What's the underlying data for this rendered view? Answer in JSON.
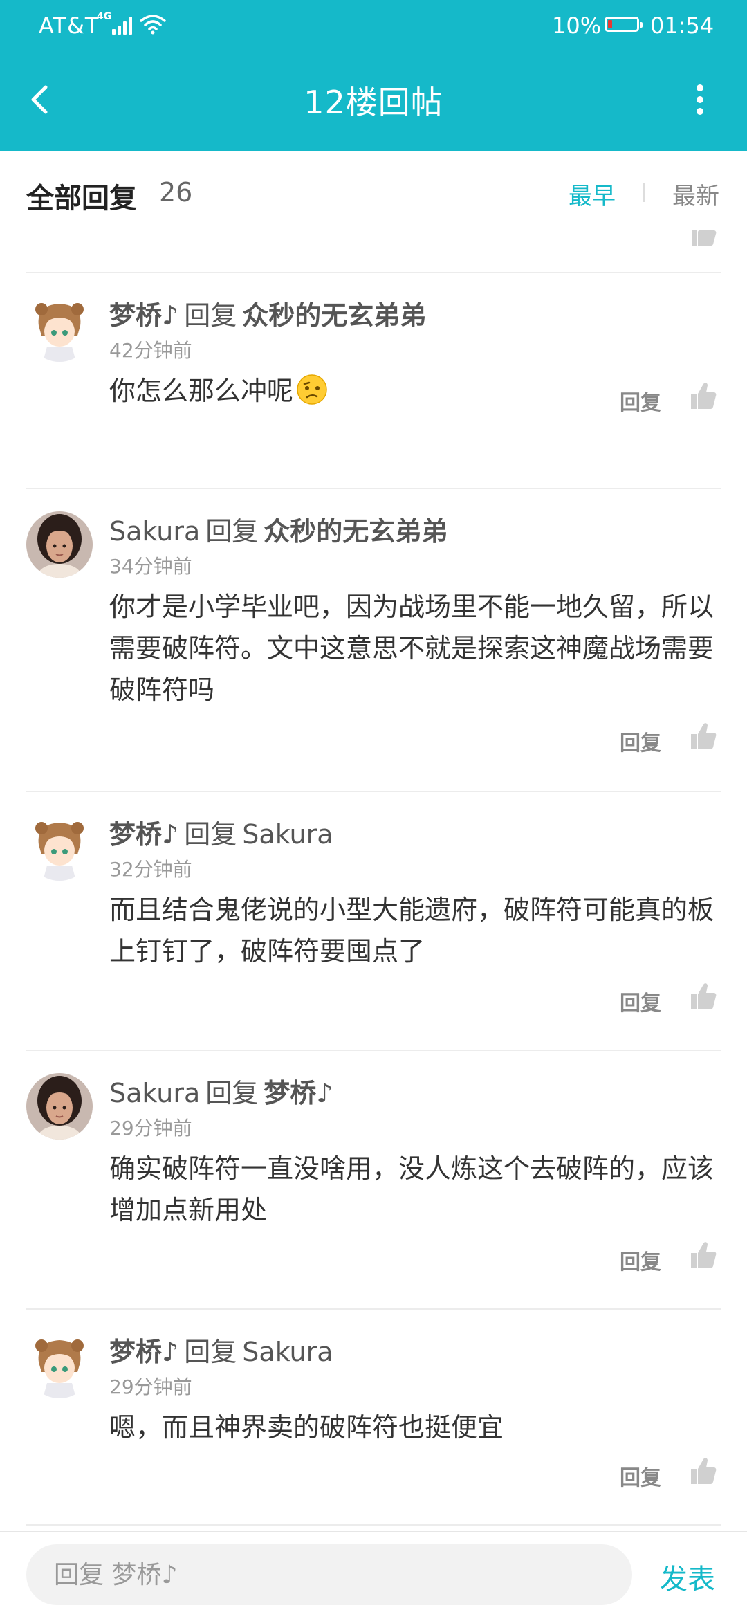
{
  "status_bar": {
    "carrier": "AT&T",
    "network": "4G",
    "battery_pct": "10%",
    "time": "01:54"
  },
  "nav": {
    "title": "12楼回帖"
  },
  "section": {
    "title": "全部回复",
    "count": "26",
    "sort_early": "最早",
    "sort_new": "最新"
  },
  "comments": [
    {
      "author": "梦桥♪",
      "reply_word": "回复",
      "target": "众秒的无玄弟弟",
      "time": "42分钟前",
      "text": "你怎么那么冲呢",
      "reply_label": "回复"
    },
    {
      "author": "Sakura",
      "reply_word": "回复",
      "target": "众秒的无玄弟弟",
      "time": "34分钟前",
      "text": "你才是小学毕业吧，因为战场里不能一地久留，所以需要破阵符。文中这意思不就是探索这神魔战场需要破阵符吗",
      "reply_label": "回复"
    },
    {
      "author": "梦桥♪",
      "reply_word": "回复",
      "target": "Sakura",
      "time": "32分钟前",
      "text": "而且结合鬼佬说的小型大能遗府，破阵符可能真的板上钉钉了，破阵符要囤点了",
      "reply_label": "回复"
    },
    {
      "author": "Sakura",
      "reply_word": "回复",
      "target": "梦桥♪",
      "time": "29分钟前",
      "text": "确实破阵符一直没啥用，没人炼这个去破阵的，应该增加点新用处",
      "reply_label": "回复"
    },
    {
      "author": "梦桥♪",
      "reply_word": "回复",
      "target": "Sakura",
      "time": "29分钟前",
      "text": "嗯，而且神界卖的破阵符也挺便宜",
      "reply_label": "回复"
    }
  ],
  "composer": {
    "placeholder": "回复 梦桥♪",
    "send_label": "发表"
  },
  "colors": {
    "accent": "#15b9c9",
    "battery_low": "#e53935"
  }
}
